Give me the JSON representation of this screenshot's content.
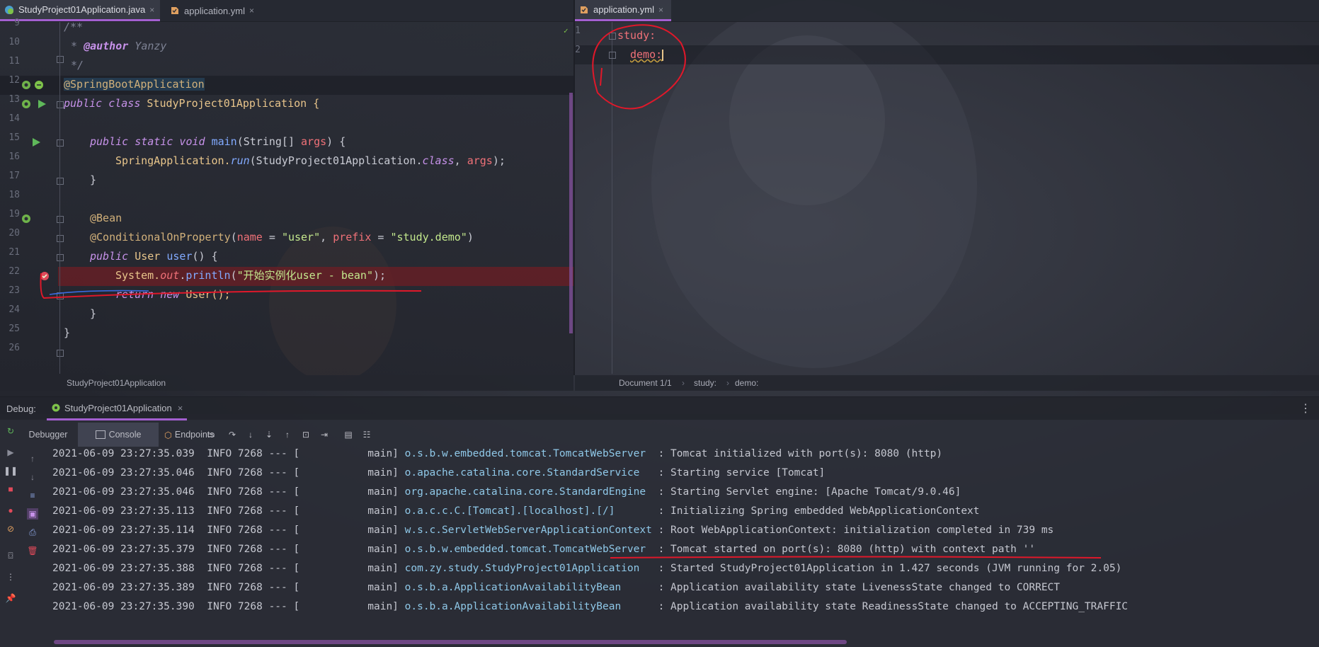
{
  "left_tabs": [
    {
      "label": "StudyProject01Application.java",
      "close": "×",
      "icon": "spring-java-icon",
      "active": true
    },
    {
      "label": "application.yml",
      "close": "×",
      "icon": "yml-icon",
      "active": false
    }
  ],
  "right_tabs": [
    {
      "label": "application.yml",
      "close": "×",
      "icon": "yml-icon",
      "active": true
    }
  ],
  "java_lines": [
    {
      "n": "9"
    },
    {
      "n": "10"
    },
    {
      "n": "11"
    },
    {
      "n": "12"
    },
    {
      "n": "13"
    },
    {
      "n": "14"
    },
    {
      "n": "15"
    },
    {
      "n": "16"
    },
    {
      "n": "17"
    },
    {
      "n": "18"
    },
    {
      "n": "19"
    },
    {
      "n": "20"
    },
    {
      "n": "21"
    },
    {
      "n": "22"
    },
    {
      "n": "23"
    },
    {
      "n": "24"
    },
    {
      "n": "25"
    },
    {
      "n": "26"
    }
  ],
  "java_code": {
    "l9": "/**",
    "l10_tag": "@author",
    "l10_name": "Yanzy",
    "l11": "*/",
    "l12": "@SpringBootApplication",
    "l13_kw": "public class",
    "l13_cls": "StudyProject01Application {",
    "l15_kw": "public static void",
    "l15_fn": "main",
    "l15_rest1": "(String[] ",
    "l15_par": "args",
    "l15_rest2": ") {",
    "l16_cls": "SpringApplication.",
    "l16_fn": "run",
    "l16_rest1": "(StudyProject01Application.",
    "l16_kw": "class",
    "l16_rest2": ", ",
    "l16_par": "args",
    "l16_rest3": ");",
    "l17": "}",
    "l19": "@Bean",
    "l20_ann": "@ConditionalOnProperty",
    "l20_p1": "(",
    "l20_k1": "name",
    "l20_e1": " = ",
    "l20_s1": "\"user\"",
    "l20_c": ", ",
    "l20_k2": "prefix",
    "l20_e2": " = ",
    "l20_s2": "\"study.demo\"",
    "l20_p2": ")",
    "l21_kw": "public",
    "l21_cls": " User ",
    "l21_fn": "user",
    "l21_rest": "() {",
    "l22_a": "System.",
    "l22_b": "out",
    "l22_c": ".",
    "l22_fn": "println",
    "l22_d": "(",
    "l22_s": "\"开始实例化user - bean\"",
    "l22_e": ");",
    "l23_kw": "return new",
    "l23_rest": " User();",
    "l24": "}",
    "l25": "}"
  },
  "yml": {
    "lines": [
      {
        "n": "1"
      },
      {
        "n": "2"
      }
    ],
    "l1": "study:",
    "l2": "demo:"
  },
  "status_left": "StudyProject01Application",
  "status_right": {
    "doc": "Document 1/1",
    "crumb1": "study:",
    "crumb2": "demo:"
  },
  "debug": {
    "label": "Debug:",
    "session": "StudyProject01Application",
    "session_close": "×",
    "tabs": [
      "Debugger",
      "Console",
      "Endpoints"
    ],
    "active_tab": "Console"
  },
  "logs": [
    {
      "date": "2021-06-09 23:27:35.039",
      "level": "INFO 7268 --- [",
      "thread": "main]",
      "logger": "o.s.b.w.embedded.tomcat.TomcatWebServer ",
      "msg": " : Tomcat initialized with port(s): 8080 (http)"
    },
    {
      "date": "2021-06-09 23:27:35.046",
      "level": "INFO 7268 --- [",
      "thread": "main]",
      "logger": "o.apache.catalina.core.StandardService  ",
      "msg": " : Starting service [Tomcat]"
    },
    {
      "date": "2021-06-09 23:27:35.046",
      "level": "INFO 7268 --- [",
      "thread": "main]",
      "logger": "org.apache.catalina.core.StandardEngine ",
      "msg": " : Starting Servlet engine: [Apache Tomcat/9.0.46]"
    },
    {
      "date": "2021-06-09 23:27:35.113",
      "level": "INFO 7268 --- [",
      "thread": "main]",
      "logger": "o.a.c.c.C.[Tomcat].[localhost].[/]      ",
      "msg": " : Initializing Spring embedded WebApplicationContext"
    },
    {
      "date": "2021-06-09 23:27:35.114",
      "level": "INFO 7268 --- [",
      "thread": "main]",
      "logger": "w.s.c.ServletWebServerApplicationContext",
      "msg": " : Root WebApplicationContext: initialization completed in 739 ms"
    },
    {
      "date": "2021-06-09 23:27:35.379",
      "level": "INFO 7268 --- [",
      "thread": "main]",
      "logger": "o.s.b.w.embedded.tomcat.TomcatWebServer ",
      "msg": " : Tomcat started on port(s): 8080 (http) with context path ''"
    },
    {
      "date": "2021-06-09 23:27:35.388",
      "level": "INFO 7268 --- [",
      "thread": "main]",
      "logger": "com.zy.study.StudyProject01Application  ",
      "msg": " : Started StudyProject01Application in 1.427 seconds (JVM running for 2.05)"
    },
    {
      "date": "2021-06-09 23:27:35.389",
      "level": "INFO 7268 --- [",
      "thread": "main]",
      "logger": "o.s.b.a.ApplicationAvailabilityBean     ",
      "msg": " : Application availability state LivenessState changed to CORRECT"
    },
    {
      "date": "2021-06-09 23:27:35.390",
      "level": "INFO 7268 --- [",
      "thread": "main]",
      "logger": "o.s.b.a.ApplicationAvailabilityBean     ",
      "msg": " : Application availability state ReadinessState changed to ACCEPTING_TRAFFIC"
    }
  ],
  "colors": {
    "accent": "#a35fd0",
    "annotation_red": "#e0182a",
    "breakpoint_line": "#5a1f24"
  }
}
